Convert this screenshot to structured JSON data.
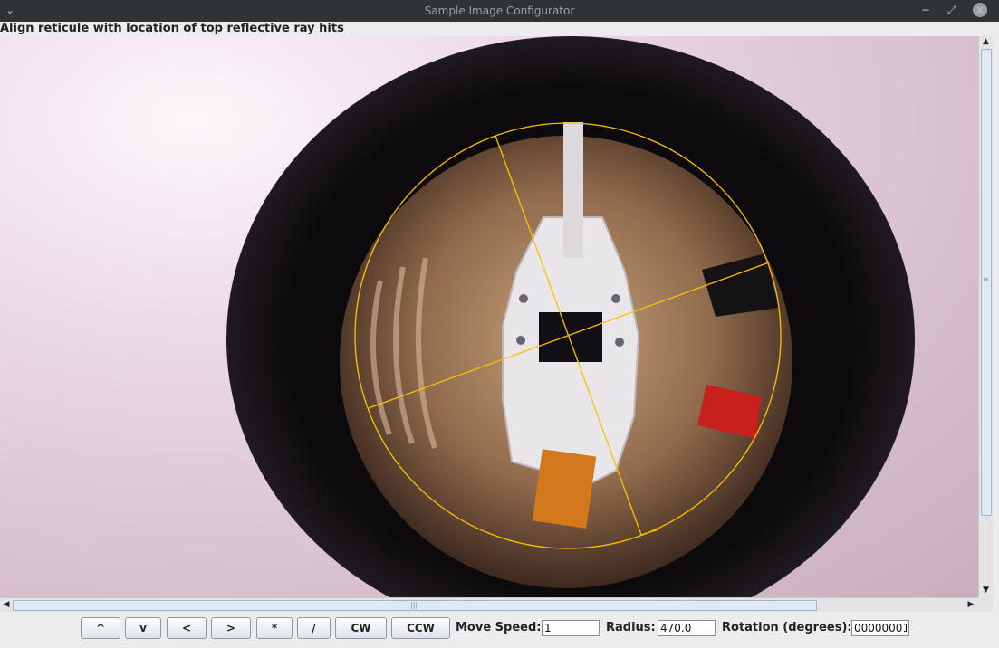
{
  "window": {
    "title": "Sample Image Configurator",
    "menu_glyph": "⌄",
    "minimize_glyph": "−",
    "maximize_glyph": "⤢",
    "close_glyph": "×"
  },
  "instruction": "Align reticule with location of top reflective ray hits",
  "reticule": {
    "color": "#ffc000",
    "style": "circle with crosshair"
  },
  "scrollbars": {
    "up_arrow": "▲",
    "down_arrow": "▼",
    "left_arrow": "◀",
    "right_arrow": "▶",
    "grip": "|||"
  },
  "controls": {
    "buttons": [
      {
        "key": "up",
        "label": "^"
      },
      {
        "key": "down",
        "label": "v"
      },
      {
        "key": "left",
        "label": "<"
      },
      {
        "key": "right",
        "label": ">"
      },
      {
        "key": "star",
        "label": "*"
      },
      {
        "key": "slash",
        "label": "/"
      },
      {
        "key": "cw",
        "label": "CW"
      },
      {
        "key": "ccw",
        "label": "CCW"
      }
    ],
    "move_speed_label": "Move Speed:",
    "move_speed_value": "1",
    "radius_label": "Radius:",
    "radius_value": "470.0",
    "rotation_label": "Rotation (degrees):",
    "rotation_value": "00000001"
  }
}
